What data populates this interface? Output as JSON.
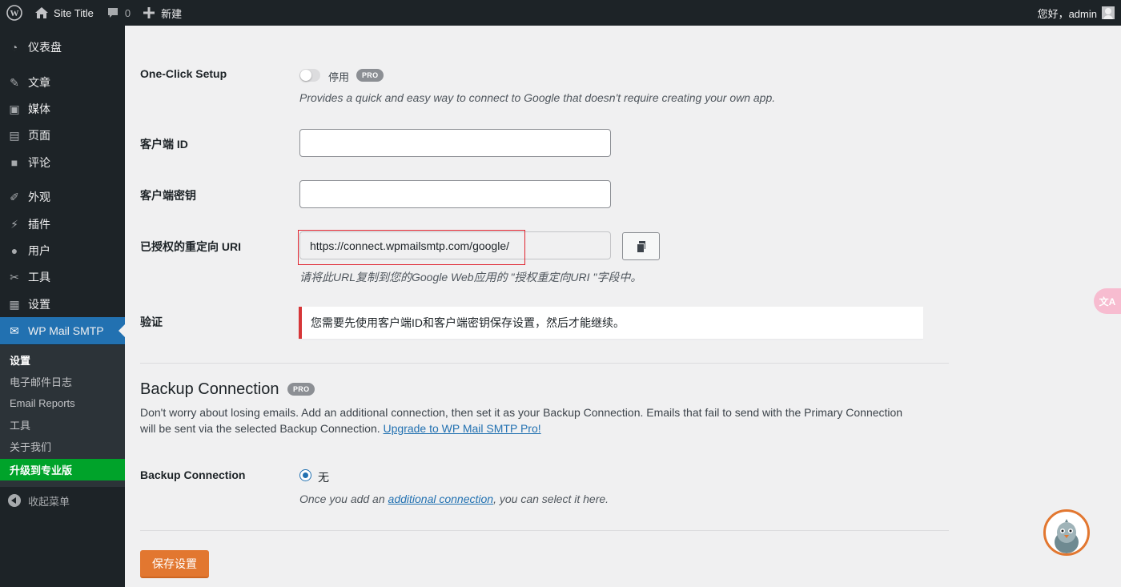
{
  "adminbar": {
    "site_title": "Site Title",
    "comments_count": "0",
    "new_label": "新建",
    "greeting": "您好，admin"
  },
  "sidebar": {
    "items": [
      {
        "label": "仪表盘",
        "icon": "dashboard-icon"
      },
      {
        "label": "文章",
        "icon": "pin-icon"
      },
      {
        "label": "媒体",
        "icon": "media-icon"
      },
      {
        "label": "页面",
        "icon": "page-icon"
      },
      {
        "label": "评论",
        "icon": "comment-icon"
      },
      {
        "label": "外观",
        "icon": "brush-icon"
      },
      {
        "label": "插件",
        "icon": "plugin-icon"
      },
      {
        "label": "用户",
        "icon": "user-icon"
      },
      {
        "label": "工具",
        "icon": "wrench-icon"
      },
      {
        "label": "设置",
        "icon": "settings-icon"
      },
      {
        "label": "WP Mail SMTP",
        "icon": "mail-icon"
      }
    ],
    "submenu": [
      "设置",
      "电子邮件日志",
      "Email Reports",
      "工具",
      "关于我们",
      "升级到专业版"
    ],
    "collapse_label": "收起菜单"
  },
  "form": {
    "one_click": {
      "label": "One-Click Setup",
      "toggle_state": "停用",
      "badge": "PRO",
      "description": "Provides a quick and easy way to connect to Google that doesn't require creating your own app."
    },
    "client_id": {
      "label": "客户端 ID",
      "value": ""
    },
    "client_secret": {
      "label": "客户端密钥",
      "value": ""
    },
    "redirect_uri": {
      "label": "已授权的重定向 URI",
      "value": "https://connect.wpmailsmtp.com/google/",
      "description": "请将此URL复制到您的Google Web应用的 \"授权重定向URI \"字段中。"
    },
    "auth": {
      "label": "验证",
      "notice": "您需要先使用客户端ID和客户端密钥保存设置，然后才能继续。"
    }
  },
  "backup": {
    "title": "Backup Connection",
    "badge": "PRO",
    "para_line1": "Don't worry about losing emails. Add an additional connection, then set it as your Backup Connection. Emails that fail to send with the Primary Connection",
    "para_line2": "will be sent via the selected Backup Connection.",
    "upgrade_link": "Upgrade to WP Mail SMTP Pro!",
    "field_label": "Backup Connection",
    "option_none": "无",
    "hint_prefix": "Once you add an",
    "hint_link": "additional connection",
    "hint_suffix": ", you can select it here."
  },
  "save_label": "保存设置",
  "translate_tab": "文A",
  "colors": {
    "adminbar": "#1d2327",
    "active_menu": "#2271b1",
    "upgrade_green": "#00a32a",
    "save_orange": "#e27730",
    "notice_red": "#d63638",
    "highlight_red": "#e0242f"
  }
}
